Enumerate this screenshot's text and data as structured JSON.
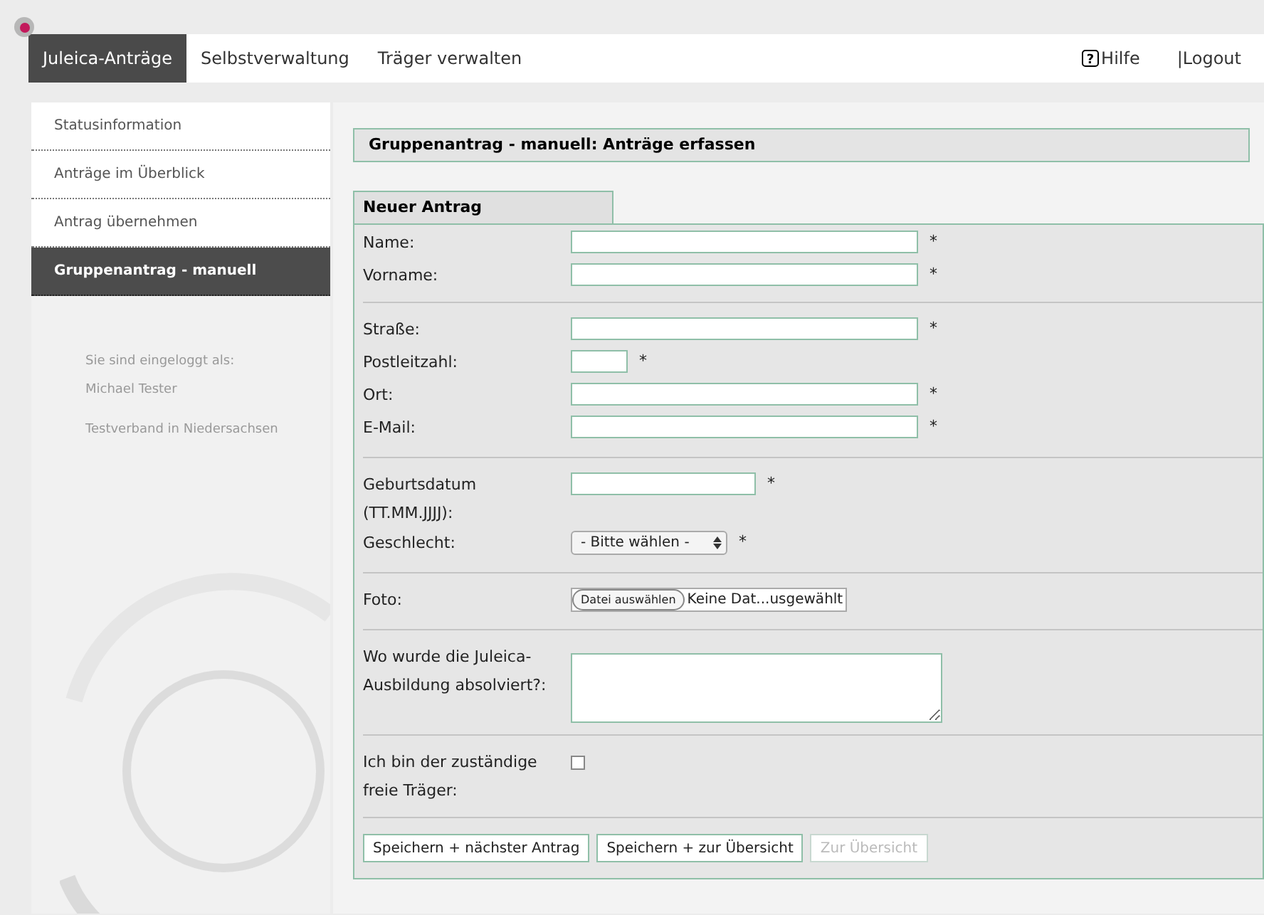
{
  "top_nav": {
    "tabs": [
      {
        "label": "Juleica-Anträge",
        "selected": true
      },
      {
        "label": "Selbstverwaltung",
        "selected": false
      },
      {
        "label": "Träger verwalten",
        "selected": false
      }
    ],
    "help_icon": "?",
    "help": "Hilfe",
    "logout": "|Logout"
  },
  "sidebar": {
    "items": [
      {
        "label": "Statusinformation",
        "selected": false
      },
      {
        "label": "Anträge im Überblick",
        "selected": false
      },
      {
        "label": "Antrag übernehmen",
        "selected": false
      },
      {
        "label": "Gruppenantrag - manuell",
        "selected": true
      }
    ],
    "login_label": "Sie sind eingeloggt als:",
    "user": "Michael Tester",
    "organization": "Testverband in Niedersachsen"
  },
  "page_title": "Gruppenantrag - manuell: Anträge erfassen",
  "form": {
    "tab": "Neuer Antrag",
    "groups": [
      [
        {
          "kind": "text",
          "label": "Name:",
          "required": "*"
        },
        {
          "kind": "text",
          "label": "Vorname:",
          "required": "*"
        }
      ],
      [
        {
          "kind": "text",
          "label": "Straße:",
          "required": "*"
        },
        {
          "kind": "short",
          "label": "Postleitzahl:",
          "required": "*"
        },
        {
          "kind": "text",
          "label": "Ort:",
          "required": "*"
        },
        {
          "kind": "text",
          "label": "E-Mail:",
          "required": "*"
        }
      ],
      [
        {
          "kind": "date",
          "label": "Geburtsdatum (TT.MM.JJJJ):",
          "required": "*"
        },
        {
          "kind": "select",
          "label": "Geschlecht:",
          "value": "- Bitte wählen -",
          "required": "*"
        }
      ],
      [
        {
          "kind": "file",
          "label": "Foto:",
          "button": "Datei auswählen",
          "value": "Keine Dat...usgewählt"
        }
      ],
      [
        {
          "kind": "textarea",
          "label": "Wo wurde die Juleica-Ausbildung absolviert?:"
        }
      ],
      [
        {
          "kind": "checkbox",
          "label": "Ich bin der zuständige freie Träger:",
          "checked": false
        }
      ]
    ],
    "buttons": [
      {
        "label": "Speichern + nächster Antrag",
        "disabled": false
      },
      {
        "label": "Speichern + zur Übersicht",
        "disabled": false
      },
      {
        "label": "Zur Übersicht",
        "disabled": true
      }
    ]
  }
}
